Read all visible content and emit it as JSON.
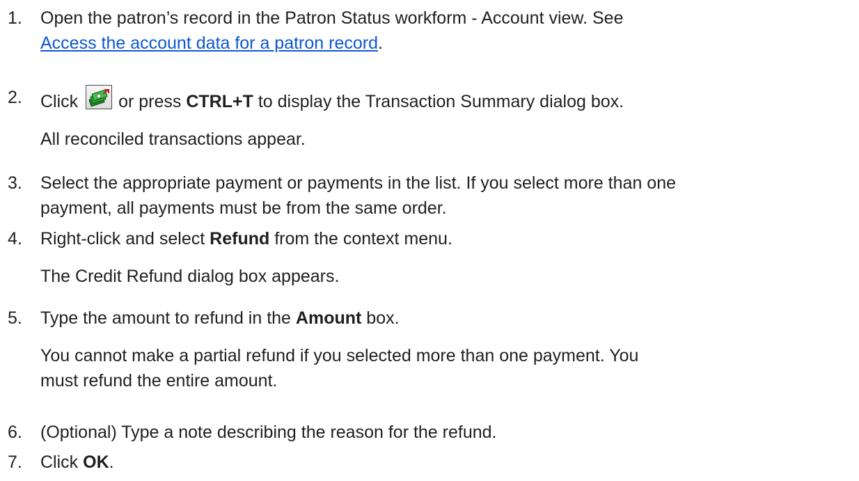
{
  "steps": [
    {
      "num": "1.",
      "text_a": "Open the patron’s record in the Patron Status workform - Account view. See",
      "link": "Access the account data for a patron record",
      "text_b": "."
    },
    {
      "num": "2.",
      "text_a": "Click",
      "icon": "transaction-summary-icon",
      "text_b": "or press",
      "bold": "CTRL+T",
      "text_c": "to display the Transaction Summary dialog box.",
      "sub": "All reconciled transactions appear."
    },
    {
      "num": "3.",
      "line1": "Select the appropriate payment or payments in the list. If you select more than one",
      "line2": "payment, all payments must be from the same order."
    },
    {
      "num": "4.",
      "text_a": "Right-click and select",
      "bold": "Refund",
      "text_b": "from the context menu.",
      "sub": "The Credit Refund dialog box appears."
    },
    {
      "num": "5.",
      "text_a": "Type the amount to refund in the",
      "bold": "Amount",
      "text_b": "box.",
      "sub1": "You cannot make a partial refund if you selected more than one payment. You",
      "sub2": "must refund the entire amount."
    },
    {
      "num": "6.",
      "text": "(Optional) Type a note describing the reason for the refund."
    },
    {
      "num": "7.",
      "text_a": "Click",
      "bold": "OK",
      "text_b": "."
    }
  ],
  "colors": {
    "text": "#1f1f1f",
    "link": "#0b57d0"
  }
}
